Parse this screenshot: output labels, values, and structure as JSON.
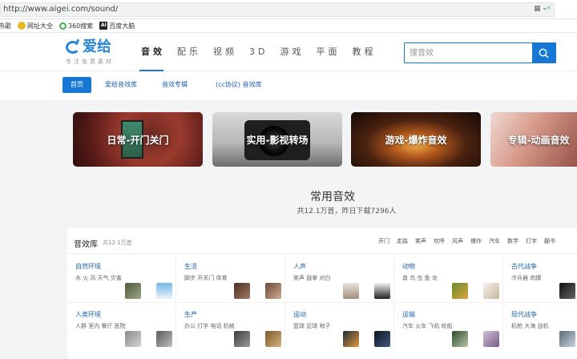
{
  "browser": {
    "url": "http://www.aigei.com/sound/",
    "bookmarks": [
      {
        "label": "热歌",
        "icon": "none"
      },
      {
        "label": "网址大全",
        "icon": "yellow-circle"
      },
      {
        "label": "360搜索",
        "icon": "360-icon"
      },
      {
        "label": "百度大脑",
        "icon": "ai-icon"
      }
    ]
  },
  "site": {
    "logo_text": "爱给",
    "logo_tagline": "专注免费素材",
    "nav": [
      "音效",
      "配乐",
      "视频",
      "3D",
      "游戏",
      "平面",
      "教程"
    ],
    "search_placeholder": "搜音效",
    "accent": "#1677d4"
  },
  "sub_nav": [
    "首页",
    "爱给音效库",
    "音效专辑",
    "(cc协议) 音效库"
  ],
  "banners": [
    "日常-开门关门",
    "实用-影视转场",
    "游戏-爆炸音效",
    "专辑-动画音效"
  ],
  "headline": {
    "title": "常用音效",
    "subtitle": "共12.1万首，昨日下载7296人"
  },
  "library": {
    "title": "音效库",
    "count": "共12.1万首",
    "tags": [
      "开门",
      "走路",
      "笑声",
      "欢呼",
      "风声",
      "爆炸",
      "汽车",
      "数学",
      "打字",
      "翻书"
    ],
    "categories": [
      {
        "title": "自然环境",
        "tags": "水 火 风 天气 灾害"
      },
      {
        "title": "生活",
        "tags": "脚步 开关门 体育"
      },
      {
        "title": "人声",
        "tags": "笑声 鼓掌 对白"
      },
      {
        "title": "动物",
        "tags": "兽 鸟 虫 鱼 龙"
      },
      {
        "title": "古代战争",
        "tags": "冷兵器 肉搏"
      },
      {
        "title": "人类环境",
        "tags": "人群 室内 餐厅 医院"
      },
      {
        "title": "生产",
        "tags": "办公 打字 电话 机械"
      },
      {
        "title": "运动",
        "tags": "篮球 足球 哨子"
      },
      {
        "title": "运输",
        "tags": "汽车 火车 飞机 轮船"
      },
      {
        "title": "现代战争",
        "tags": "机枪 大海 战机"
      }
    ]
  }
}
